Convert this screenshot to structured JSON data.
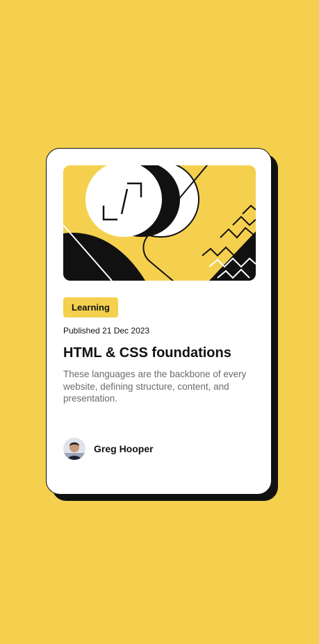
{
  "card": {
    "tag": "Learning",
    "published": "Published 21 Dec 2023",
    "title": "HTML & CSS foundations",
    "description": "These languages are the backbone of every website, defining structure, content, and presentation.",
    "author": {
      "name": "Greg Hooper"
    }
  },
  "colors": {
    "background": "#f4d04e",
    "card": "#ffffff",
    "ink": "#111111",
    "muted": "#6b6b6b"
  },
  "icons": {
    "hero": "abstract-illustration",
    "avatar": "author-avatar"
  }
}
